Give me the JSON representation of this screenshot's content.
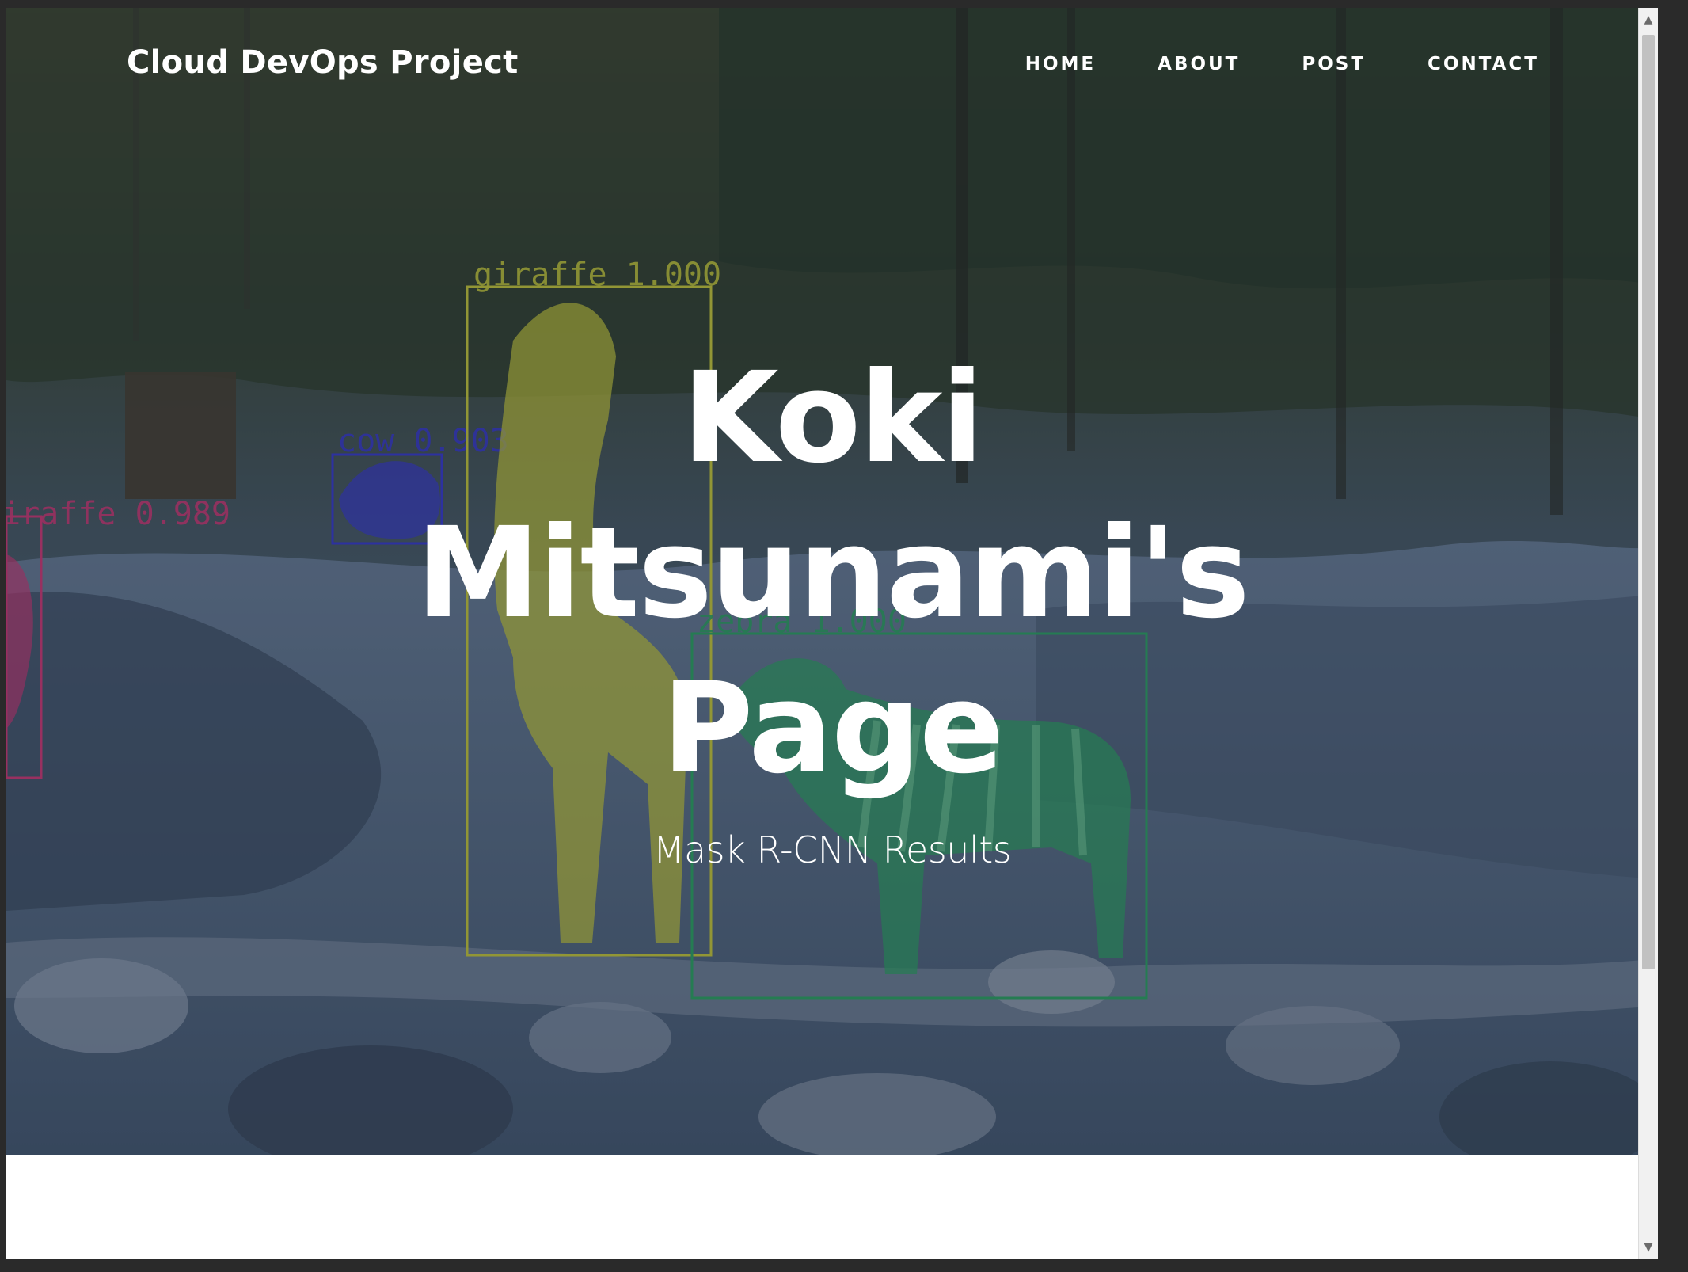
{
  "brand": {
    "title": "Cloud DevOps Project"
  },
  "nav": {
    "items": [
      {
        "label": "HOME"
      },
      {
        "label": "ABOUT"
      },
      {
        "label": "POST"
      },
      {
        "label": "CONTACT"
      }
    ]
  },
  "hero": {
    "title": "Koki Mitsunami's Page",
    "subheading": "Mask R-CNN Results",
    "detections": [
      {
        "label": "giraffe 1.000",
        "color": "#cfcf3a"
      },
      {
        "label": "cow 0.903",
        "color": "#3a3ad8"
      },
      {
        "label": "iraffe 0.989",
        "color": "#d8387a"
      },
      {
        "label": "zebra 1.000",
        "color": "#2fa865"
      }
    ]
  },
  "scrollbar": {
    "up_icon": "▲",
    "down_icon": "▼"
  }
}
